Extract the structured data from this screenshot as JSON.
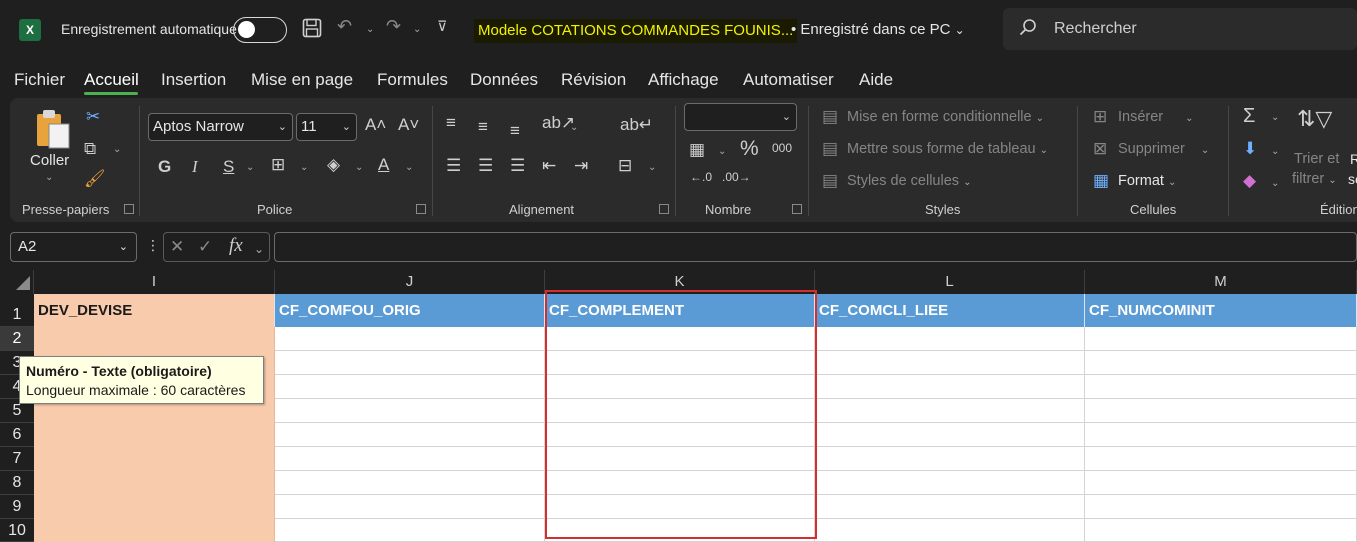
{
  "titlebar": {
    "app_icon": "excel-icon",
    "autosave_label": "Enregistrement automatique",
    "doc_title": "Modele COTATIONS   COMMANDES FOUNIS...",
    "saved_status": "• Enregistré dans ce PC",
    "search_placeholder": "Rechercher"
  },
  "menu": {
    "tabs": [
      "Fichier",
      "Accueil",
      "Insertion",
      "Mise en page",
      "Formules",
      "Données",
      "Révision",
      "Affichage",
      "Automatiser",
      "Aide"
    ],
    "active": "Accueil"
  },
  "ribbon": {
    "clipboard": {
      "paste_label": "Coller",
      "group_label": "Presse-papiers"
    },
    "font": {
      "font_name": "Aptos Narrow",
      "font_size": "11",
      "bold": "G",
      "italic": "I",
      "underline": "S",
      "group_label": "Police"
    },
    "alignment": {
      "group_label": "Alignement"
    },
    "number": {
      "format_value": "",
      "percent": "%",
      "thousands": "000",
      "group_label": "Nombre"
    },
    "styles": {
      "conditional": "Mise en forme conditionnelle",
      "as_table": "Mettre sous forme de tableau",
      "cell_styles": "Styles de cellules",
      "group_label": "Styles"
    },
    "cells": {
      "insert": "Insérer",
      "delete": "Supprimer",
      "format": "Format",
      "group_label": "Cellules"
    },
    "editing": {
      "sort_filter_1": "Trier et",
      "sort_filter_2": "filtrer",
      "group_label": "Édition"
    }
  },
  "formula_bar": {
    "name_box": "A2",
    "fx": "fx",
    "formula": ""
  },
  "grid": {
    "columns": [
      "I",
      "J",
      "K",
      "L",
      "M"
    ],
    "rows": [
      "1",
      "2",
      "3",
      "4",
      "5",
      "6",
      "7",
      "8",
      "9",
      "10"
    ],
    "selected_row": "2",
    "headers": [
      "DEV_DEVISE",
      "CF_COMFOU_ORIG",
      "CF_COMPLEMENT",
      "CF_COMCLI_LIEE",
      "CF_NUMCOMINIT"
    ]
  },
  "tooltip": {
    "title": "Numéro - Texte (obligatoire)",
    "body": "Longueur maximale : 60 caractères"
  },
  "colors": {
    "header_blue": "#5b9bd5",
    "header_orange": "#f8cbad",
    "highlight_red": "#d32f2f",
    "tab_active": "#4caf50"
  }
}
